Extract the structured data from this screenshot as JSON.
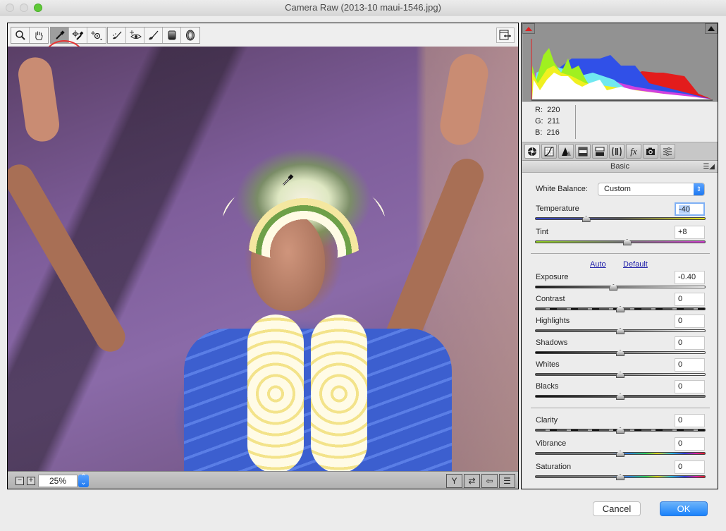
{
  "window": {
    "title": "Camera Raw (2013-10 maui-1546.jpg)"
  },
  "toolbar": {
    "tools": [
      {
        "name": "zoom-tool",
        "icon": "magnifier-icon",
        "glyph": "🔍︎"
      },
      {
        "name": "hand-tool",
        "icon": "hand-icon",
        "glyph": "✋︎"
      },
      {
        "name": "white-balance-tool",
        "icon": "eyedropper-icon",
        "glyph": "✒",
        "active": true
      },
      {
        "name": "color-sampler-tool",
        "icon": "color-sampler-icon",
        "glyph": "⌖"
      },
      {
        "name": "targeted-adjustment-tool",
        "icon": "target-adjust-icon",
        "glyph": "⊙"
      },
      {
        "name": "spot-removal-tool",
        "icon": "spot-removal-icon",
        "glyph": "⁄"
      },
      {
        "name": "red-eye-tool",
        "icon": "eye-icon",
        "glyph": "👁︎"
      },
      {
        "name": "adjustment-brush-tool",
        "icon": "brush-icon",
        "glyph": "⁄"
      },
      {
        "name": "graduated-filter-tool",
        "icon": "graduated-filter-icon",
        "glyph": "▮"
      },
      {
        "name": "radial-filter-tool",
        "icon": "radial-filter-icon",
        "glyph": "⬯"
      }
    ],
    "fullscreen_icon": "toggle-fullscreen-icon"
  },
  "preview": {
    "zoom_level": "25%",
    "bottom_tools": [
      {
        "name": "before-after-view",
        "glyph": "Y"
      },
      {
        "name": "swap-before-after",
        "glyph": "⇄"
      },
      {
        "name": "copy-after-to-before",
        "glyph": "⇦"
      },
      {
        "name": "toggle-settings",
        "glyph": "☰"
      }
    ]
  },
  "histogram": {
    "rgb": {
      "r_label": "R:",
      "r": "220",
      "g_label": "G:",
      "g": "211",
      "b_label": "B:",
      "b": "216"
    }
  },
  "panel_tabs": [
    {
      "name": "basic",
      "glyph": "◉",
      "active": true
    },
    {
      "name": "tone-curve",
      "glyph": "⌇"
    },
    {
      "name": "detail",
      "glyph": "▲"
    },
    {
      "name": "hsl-grayscale",
      "glyph": "▤"
    },
    {
      "name": "split-toning",
      "glyph": "▬"
    },
    {
      "name": "lens-corrections",
      "glyph": "◫"
    },
    {
      "name": "effects",
      "glyph": "fx"
    },
    {
      "name": "camera-calibration",
      "glyph": "◙"
    },
    {
      "name": "presets",
      "glyph": "☷"
    }
  ],
  "basic_panel": {
    "title": "Basic",
    "white_balance_label": "White Balance:",
    "white_balance_value": "Custom",
    "auto_label": "Auto",
    "default_label": "Default",
    "sliders": [
      {
        "label": "Temperature",
        "value": "-40",
        "position": 0.3
      },
      {
        "label": "Tint",
        "value": "+8",
        "position": 0.54
      },
      {
        "label": "Exposure",
        "value": "-0.40",
        "position": 0.46
      },
      {
        "label": "Contrast",
        "value": "0",
        "position": 0.5
      },
      {
        "label": "Highlights",
        "value": "0",
        "position": 0.5
      },
      {
        "label": "Shadows",
        "value": "0",
        "position": 0.5
      },
      {
        "label": "Whites",
        "value": "0",
        "position": 0.5
      },
      {
        "label": "Blacks",
        "value": "0",
        "position": 0.5
      },
      {
        "label": "Clarity",
        "value": "0",
        "position": 0.5
      },
      {
        "label": "Vibrance",
        "value": "0",
        "position": 0.5
      },
      {
        "label": "Saturation",
        "value": "0",
        "position": 0.5
      }
    ]
  },
  "buttons": {
    "cancel": "Cancel",
    "ok": "OK"
  }
}
